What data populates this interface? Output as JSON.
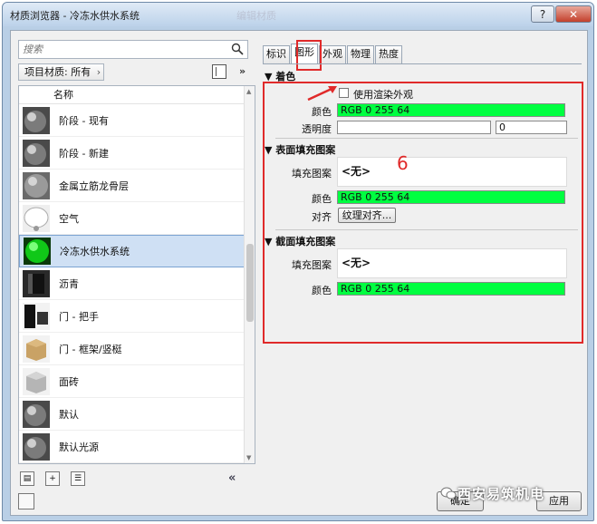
{
  "window": {
    "title": "材质浏览器 - 冷冻水供水系统",
    "background_title": "编辑材质"
  },
  "search": {
    "placeholder": "搜索"
  },
  "filter": {
    "label": "项目材质: 所有"
  },
  "list": {
    "header": "名称",
    "items": [
      {
        "label": "阶段 - 现有",
        "swatch": "gray-sphere"
      },
      {
        "label": "阶段 - 新建",
        "swatch": "gray-sphere"
      },
      {
        "label": "金属立筋龙骨层",
        "swatch": "metal-sphere"
      },
      {
        "label": "空气",
        "swatch": "air-sphere"
      },
      {
        "label": "冷冻水供水系统",
        "swatch": "green-sphere",
        "selected": true
      },
      {
        "label": "沥青",
        "swatch": "dark-tile"
      },
      {
        "label": "门 - 把手",
        "swatch": "handle-tile"
      },
      {
        "label": "门 - 框架/竖梃",
        "swatch": "wood-cube"
      },
      {
        "label": "面砖",
        "swatch": "tile-cube"
      },
      {
        "label": "默认",
        "swatch": "gray-sphere"
      },
      {
        "label": "默认光源",
        "swatch": "gray-sphere"
      }
    ]
  },
  "tabs": [
    {
      "label": "标识"
    },
    {
      "label": "图形",
      "active": true
    },
    {
      "label": "外观"
    },
    {
      "label": "物理"
    },
    {
      "label": "热度"
    }
  ],
  "shading": {
    "header": "着色",
    "use_render_label": "使用渲染外观",
    "color_label": "颜色",
    "color_value": "RGB 0 255 64",
    "transparency_label": "透明度",
    "transparency_value": "0"
  },
  "surface_pattern": {
    "header": "表面填充图案",
    "fill_label": "填充图案",
    "fill_value": "<无>",
    "color_label": "颜色",
    "color_value": "RGB 0 255 64",
    "align_label": "对齐",
    "align_button": "纹理对齐..."
  },
  "cut_pattern": {
    "header": "截面填充图案",
    "fill_label": "填充图案",
    "fill_value": "<无>",
    "color_label": "颜色",
    "color_value": "RGB 0 255 64"
  },
  "annotation": {
    "number": "6"
  },
  "footer": {
    "ok": "确定",
    "apply": "应用"
  },
  "watermark": "西安易筑机电",
  "colors": {
    "material_green": "#00ff40",
    "annotation_red": "#e02a2a"
  }
}
